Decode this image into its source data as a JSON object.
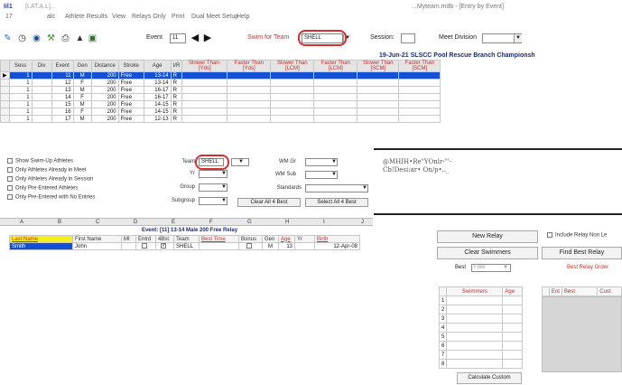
{
  "titlebar": {
    "app_icon_text": "Iil1",
    "app_title": "[LAT.A.L]...",
    "doc_title": "...Myteam.mdb - [Entry by Event]"
  },
  "menubar": {
    "items": [
      "17",
      "alc",
      "Athlete Results",
      "View",
      "Relays Only",
      "Print",
      "Dual Meet Setup",
      "Help"
    ]
  },
  "toolbar": {
    "event_label": "Event",
    "event_value": "11",
    "swim_for_team_label": "Swim for Team",
    "swim_for_team_value": "SHELL",
    "session_label": "Session:",
    "session_value": "",
    "meet_division_label": "Meet Division",
    "meet_division_value": ""
  },
  "meet_title": "19-Jun-21  SLSCC Pool Rescue Branch Championsh",
  "relay_grid": {
    "headers": [
      "Sess",
      "Div",
      "Event",
      "Gen",
      "Distance",
      "Stroke",
      "Age",
      "I/R",
      "Slower Than-[Yds]",
      "Faster Than [Yds]",
      "Slower Than [LCM]",
      "Faster Than [LCM]",
      "Slower Than [SCM]",
      "Faster Than [SCM]"
    ],
    "rows": [
      [
        "1",
        "",
        "11",
        "M",
        "200",
        "Free",
        "13-14",
        "R"
      ],
      [
        "1",
        "",
        "12",
        "F",
        "200",
        "Free",
        "13-14",
        "R"
      ],
      [
        "1",
        "",
        "13",
        "M",
        "200",
        "Free",
        "16-17",
        "R"
      ],
      [
        "1",
        "",
        "14",
        "F",
        "200",
        "Free",
        "16-17",
        "R"
      ],
      [
        "1",
        "",
        "15",
        "M",
        "200",
        "Free",
        "14-15",
        "R"
      ],
      [
        "1",
        "",
        "16",
        "F",
        "200",
        "Free",
        "14-15",
        "R"
      ],
      [
        "1",
        "",
        "17",
        "M",
        "200",
        "Free",
        "12-13",
        "R"
      ]
    ]
  },
  "filters": {
    "checkboxes": [
      "Show Swim-Up Athletes",
      "Only Athletes Already in Meet",
      "Only Athletes Already in Session",
      "Only Pre-Entered Athletes",
      "Only Pre-Entered with No Entries"
    ],
    "team_label": "Team",
    "team_value": "SHELL",
    "yr_label": "Yr",
    "group_label": "Group",
    "subgroup_label": "Subgroup",
    "wm_gr_label": "WM Gr",
    "wm_sub_label": "WM Sub",
    "standards_label": "Standards",
    "clear_all_label": "Clear All 4 Best",
    "select_all_label": "Select All 4 Best"
  },
  "col_letters": [
    "A",
    "B",
    "C",
    "D",
    "E",
    "F",
    "G",
    "H",
    "I",
    "J"
  ],
  "event_caption": "Event: [11] 13-14 Male  200 Free Relay",
  "swimmer_grid": {
    "headers": [
      "Last Name",
      "First Name",
      "MI",
      "Entrd",
      "4Bst",
      "Team",
      "Best Time",
      "Bonus",
      "Gen",
      "Age",
      "Yr",
      "Birth"
    ],
    "rows": [
      [
        "Smith",
        "John",
        "",
        "",
        "",
        "SHELL",
        "",
        "",
        "M",
        "13",
        "",
        "12-Apr-08"
      ]
    ]
  },
  "overlay_text": {
    "line1": "@MHIH•Re\"YOnlr·\"'-",
    "line2": "Cb!Desi:ar• On/p•.._"
  },
  "relay_panel": {
    "new_relay_label": "New Relay",
    "include_relay_label": "Include Relay Non Le",
    "clear_swimmers_label": "Clear Swimmers",
    "find_best_label": "Find Best Relay",
    "best_label": "Best",
    "best_value": "Free",
    "best_relay_order_label": "Best Relay Order",
    "swimmers_header": "Swimmers",
    "age_header": "Age",
    "ent_header": "Ent",
    "best_header": "Best",
    "cust_header": "Cust",
    "row_numbers": [
      "1",
      "2",
      "3",
      "4",
      "5",
      "6",
      "7",
      "8"
    ],
    "calculate_label": "Calculate Custom"
  }
}
